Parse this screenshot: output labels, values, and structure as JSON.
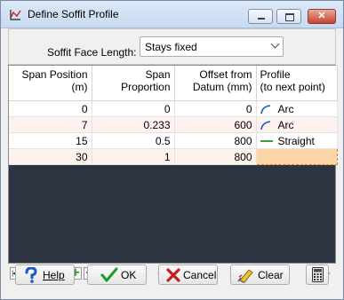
{
  "window": {
    "title": "Define Soffit Profile",
    "colors": {
      "title_bg": "#c8daf0",
      "grid_bg": "#2b3440",
      "selected_cell": "#fcd5a6",
      "row_alt": "#fdf2ee"
    }
  },
  "soffit": {
    "label": "Soffit Face Length:",
    "value": "Stays fixed"
  },
  "table": {
    "headers": [
      {
        "line1": "Span Position",
        "line2": "(m)"
      },
      {
        "line1": "Span",
        "line2": "Proportion"
      },
      {
        "line1": "Offset from",
        "line2": "Datum (mm)"
      },
      {
        "line1": "Profile",
        "line2": "(to next point)"
      }
    ],
    "rows": [
      {
        "position": "0",
        "proportion": "0",
        "offset": "0",
        "profile": "Arc",
        "profile_icon": "arc-icon"
      },
      {
        "position": "7",
        "proportion": "0.233",
        "offset": "600",
        "profile": "Arc",
        "profile_icon": "arc-icon"
      },
      {
        "position": "15",
        "proportion": "0.5",
        "offset": "800",
        "profile": "Straight",
        "profile_icon": "straight-line-icon"
      },
      {
        "position": "30",
        "proportion": "1",
        "offset": "800",
        "profile": "",
        "profile_icon": ""
      }
    ]
  },
  "navigator": {
    "buttons": [
      "first-icon",
      "prior-icon",
      "next-icon",
      "last-icon",
      "plus-icon",
      "minus-icon"
    ]
  },
  "buttons": {
    "help": "Help",
    "ok": "OK",
    "cancel": "Cancel",
    "clear": "Clear",
    "calculator_icon": "calculator-icon"
  }
}
